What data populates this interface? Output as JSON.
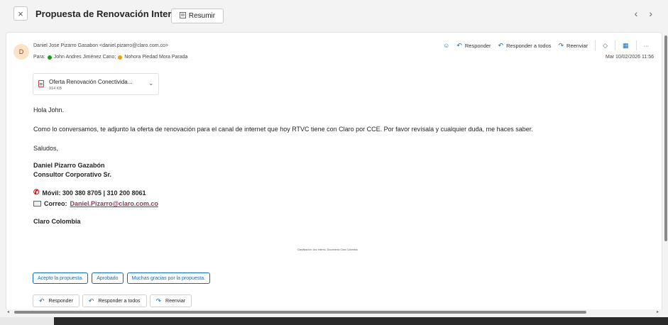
{
  "window": {
    "close_glyph": "×",
    "subject": "Propuesta de Renovación Internet CCE",
    "summarize_label": "Resumir",
    "summarize_icon": "summarize-icon",
    "nav_prev": "‹",
    "nav_next": "›"
  },
  "message": {
    "avatar_initial": "D",
    "from": "Daniel Jose Pizarro Gasabon <daniel.pizarro@claro.com.co>",
    "to_label": "Para:",
    "recipients": [
      {
        "name": "John Andres Jiménez Cano;",
        "status_color": "#13a10e"
      },
      {
        "name": "Nohora Piedad Mora Parada",
        "status_color": "#eaa300"
      }
    ],
    "date": "Mar 10/02/2026 11:56",
    "actions": {
      "emoji": "☺",
      "reply": "Responder",
      "reply_all": "Responder a todos",
      "forward": "Reenviar",
      "more": "···"
    },
    "attachment": {
      "name": "Oferta Renovación Conectivida...",
      "size": "914 KB"
    },
    "body": {
      "greeting": "Hola John.",
      "paragraph": "Como lo conversamos, te adjunto la oferta de renovación para el canal de internet que hoy RTVC tiene con Claro por CCE. Por favor revísala y cualquier duda, me haces saber.",
      "closing": "Saludos,",
      "sig_name": "Daniel Pizarro Gazabón",
      "sig_title": "Consultor Corporativo Sr.",
      "sig_phone": "Móvil: 300 380 8705 | 310 200 8061",
      "sig_mail_label": "Correo:",
      "sig_mail": "Daniel.Pizarro@claro.com.co",
      "sig_company": "Claro Colombia",
      "classification": "Clasificación: Uso Interno. Documento Claro Colombia"
    },
    "quick_replies": [
      "Acepto la propuesta.",
      "Aprobado",
      "Muchas gracias por la propuesta."
    ],
    "bottom_actions": {
      "reply": "Responder",
      "reply_all": "Responder a todos",
      "forward": "Reenviar"
    }
  },
  "colors": {
    "accent": "#0f6cbd",
    "link": "#8b3a62"
  }
}
